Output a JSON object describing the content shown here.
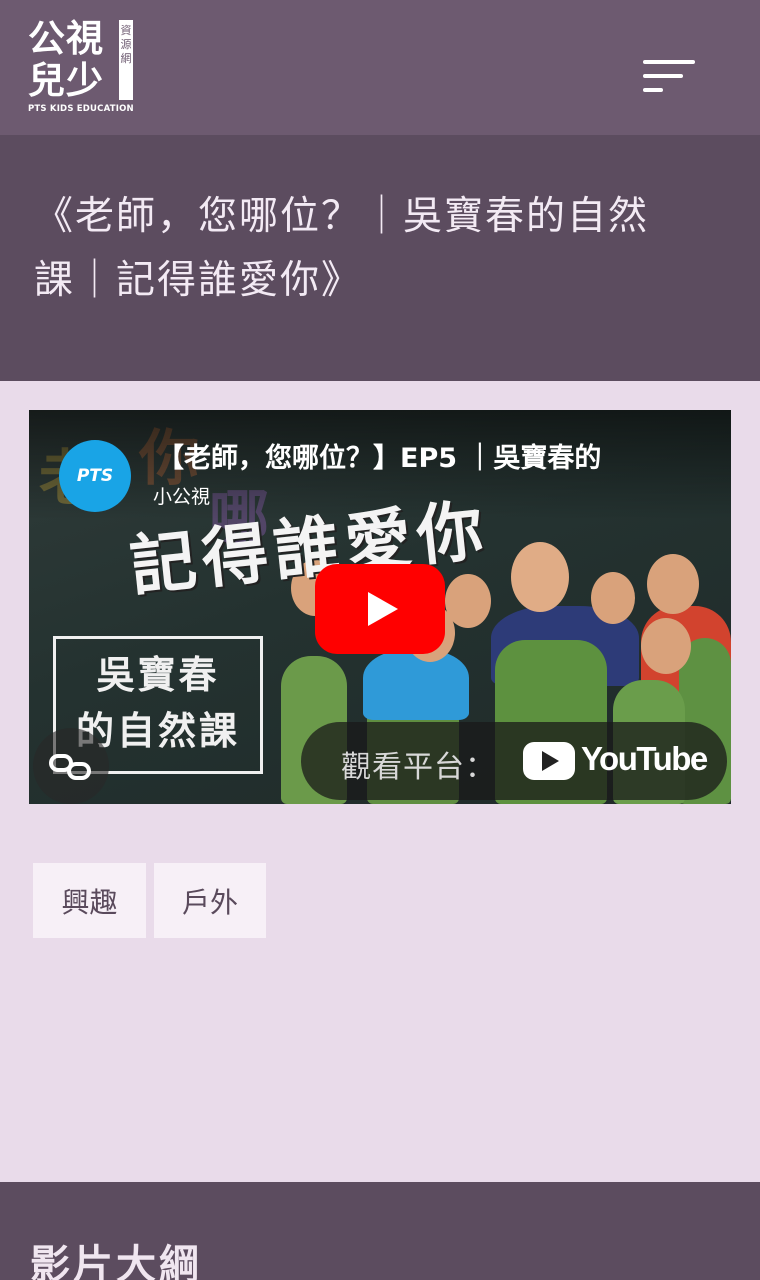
{
  "header": {
    "logo_main": "公視兒少",
    "logo_tag": "資源網",
    "logo_en": "PTS KIDS EDUCATION",
    "menu_icon": "hamburger-menu-icon"
  },
  "page": {
    "title": "《老師，您哪位？｜吳寶春的自然課｜記得誰愛你》"
  },
  "video": {
    "title": "【老師，您哪位？】EP5 ｜吳寶春的",
    "channel_badge": "PTS",
    "channel_name": "小公視",
    "thumbnail_headline": "記得誰愛你",
    "thumbnail_box_line1": "吳寶春",
    "thumbnail_box_line2": "的自然課",
    "watch_on_label": "觀看平台：",
    "platform_name": "YouTube",
    "play_icon": "play-icon",
    "share_icon": "link-icon"
  },
  "tags": [
    "興趣",
    "戶外"
  ],
  "section": {
    "title": "影片大綱"
  },
  "colors": {
    "header_bg": "#6d5a70",
    "title_band_bg": "#5c4c5f",
    "page_bg": "#e9dbea",
    "youtube_red": "#ff0000"
  }
}
